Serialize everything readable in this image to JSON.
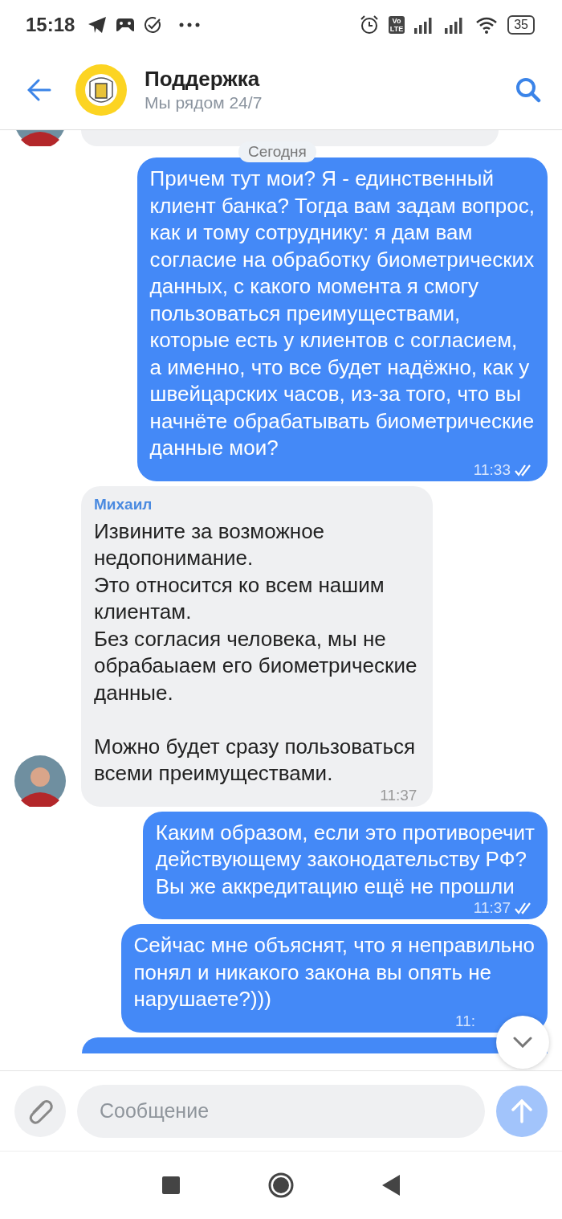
{
  "status_bar": {
    "time": "15:18",
    "volte_top": "Vo",
    "volte_bottom": "LTE",
    "battery": "35"
  },
  "header": {
    "title": "Поддержка",
    "subtitle": "Мы рядом 24/7"
  },
  "date_chip": "Сегодня",
  "messages": [
    {
      "kind": "cut"
    },
    {
      "kind": "outgoing",
      "text": "Причем тут мои? Я - единственный\nклиент банка? Тогда вам задам вопрос,\nкак и тому сотруднику: я дам вам\nсогласие на обработку биометрических\nданных, с какого момента я смогу\nпользоваться преимуществами,\nкоторые есть у клиентов с согласием,\nа именно, что все будет надёжно, как у\nшвейцарских часов, из-за того, что вы\nначнёте обрабатывать биометрические\nданные мои?",
      "time": "11:33",
      "read": true
    },
    {
      "kind": "incoming",
      "author": "Михаил",
      "text": "Извините за возможное\nнедопонимание.\nЭто относится ко всем нашим\nклиентам.\nБез согласия человека, мы не\nобрабаыаем его биометрические\nданные.\n\nМожно будет сразу пользоваться\nвсеми преимуществами.",
      "time": "11:37"
    },
    {
      "kind": "outgoing",
      "text": "Каким образом, если это противоречит\nдействующему законодательству РФ?\nВы же аккредитацию ещё не прошли",
      "time": "11:37",
      "read": true
    },
    {
      "kind": "outgoing",
      "text": "Сейчас мне объяснят, что я неправильно\nпонял и никакого закона вы опять не\nнарушаете?)))",
      "time": "11:"
    },
    {
      "kind": "cut_bottom"
    }
  ],
  "composer": {
    "placeholder": "Сообщение",
    "send_disabled": true
  }
}
